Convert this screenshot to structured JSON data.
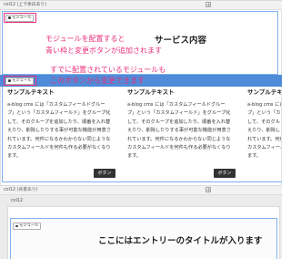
{
  "colors": {
    "frame_blue": "#7fb0ee",
    "band_blue": "#4f8bd8",
    "annotation_pink": "#e8307c",
    "button_dark": "#333333",
    "panel_gray": "#ebebeb"
  },
  "icons": {
    "section_header": "grid-icon",
    "module_badge": "dot-icon"
  },
  "top_section": {
    "label": "col12 (上下余白あり)",
    "module_a": {
      "badge": "モジュール",
      "heading": "サービス内容"
    },
    "annotation_a": [
      "モジュールを配置すると",
      "青い枠と変更ボタンが追加されます"
    ],
    "annotation_b": [
      "すでに配置されているモジュールも",
      "このボタンから変更できます"
    ],
    "module_b": {
      "badge": "モジュール",
      "columns": [
        {
          "title": "サンプルテキスト",
          "lines": [
            "a-blog cms には「カスタムフィールドグルー",
            "プ」という「カスタムフィールド」をグループ化",
            "して、そのグループを追加したり、順番を入れ替",
            "えたり、削除したりする事が可能な機能が用意さ",
            "れています。何件になるかわからない同じような",
            "カスタムフィールドを何件も作る必要がなくなり",
            "ます。"
          ],
          "button": "ボタン"
        },
        {
          "title": "サンプルテキスト",
          "lines": [
            "a-blog cms には「カスタムフィールドグルー",
            "プ」という「カスタムフィールド」をグループ化",
            "して、そのグループを追加したり、順番を入れ替",
            "えたり、削除したりする事が可能な機能が用意さ",
            "れています。何件になるかわからない同じような",
            "カスタムフィールドを何件も作る必要がなくなり",
            "ます。"
          ],
          "button": "ボタン"
        },
        {
          "title": "サンプルテキ",
          "lines": [
            "a-blog cms には",
            "プ」という「カ",
            "して、そのグル",
            "えたり、削除し",
            "れています。何件",
            "カスタムフィール",
            "ます。"
          ]
        }
      ]
    }
  },
  "bottom_section": {
    "label": "col12 (背景あり)",
    "inner_label": "col12",
    "module_badge": "モジュール",
    "entry_title": "ここにはエントリーのタイトルが入ります"
  }
}
